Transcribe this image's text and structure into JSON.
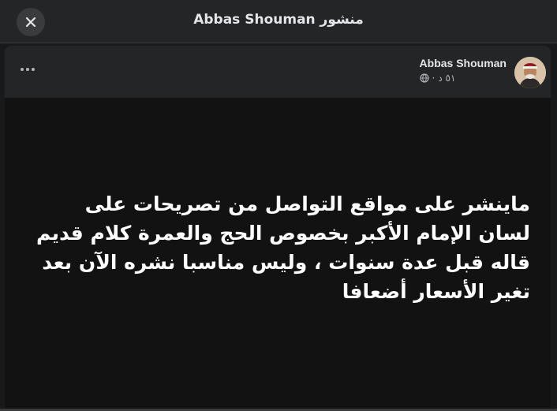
{
  "topbar": {
    "title": "منشور Abbas Shouman",
    "close_icon": "close-icon"
  },
  "post": {
    "author": "Abbas Shouman",
    "time": "٥١ د",
    "privacy_icon": "globe-icon",
    "more_icon": "more-horizontal-icon",
    "text": "ماينشر على مواقع التواصل من تصريحات على لسان الإمام الأكبر بخصوص الحج والعمرة كلام قديم قاله قبل عدة سنوات ، وليس مناسبا نشره الآن بعد تغير الأسعار أضعافا"
  },
  "colors": {
    "background": "#18191a",
    "surface": "#242526",
    "text_primary": "#e4e6eb",
    "text_secondary": "#b0b3b8",
    "post_background": "#121212"
  }
}
